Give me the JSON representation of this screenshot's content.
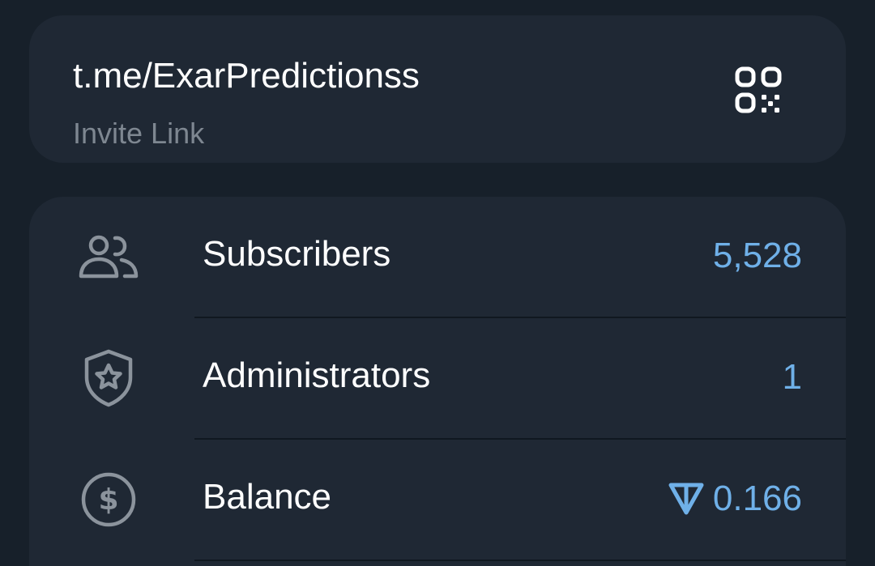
{
  "invite": {
    "link": "t.me/ExarPredictionss",
    "caption": "Invite Link",
    "qr_icon": "qr-code-icon"
  },
  "stats": {
    "rows": [
      {
        "label": "Subscribers",
        "value": "5,528",
        "icon": "users-icon"
      },
      {
        "label": "Administrators",
        "value": "1",
        "icon": "shield-star-icon"
      },
      {
        "label": "Balance",
        "value": "0.166",
        "icon": "dollar-circle-icon",
        "currency_icon": "ton-icon"
      }
    ]
  },
  "colors": {
    "background": "#17202a",
    "card": "#1f2834",
    "accent": "#6fb0e8",
    "secondary_text": "#7e8791",
    "icon_gray": "#8b939c"
  }
}
